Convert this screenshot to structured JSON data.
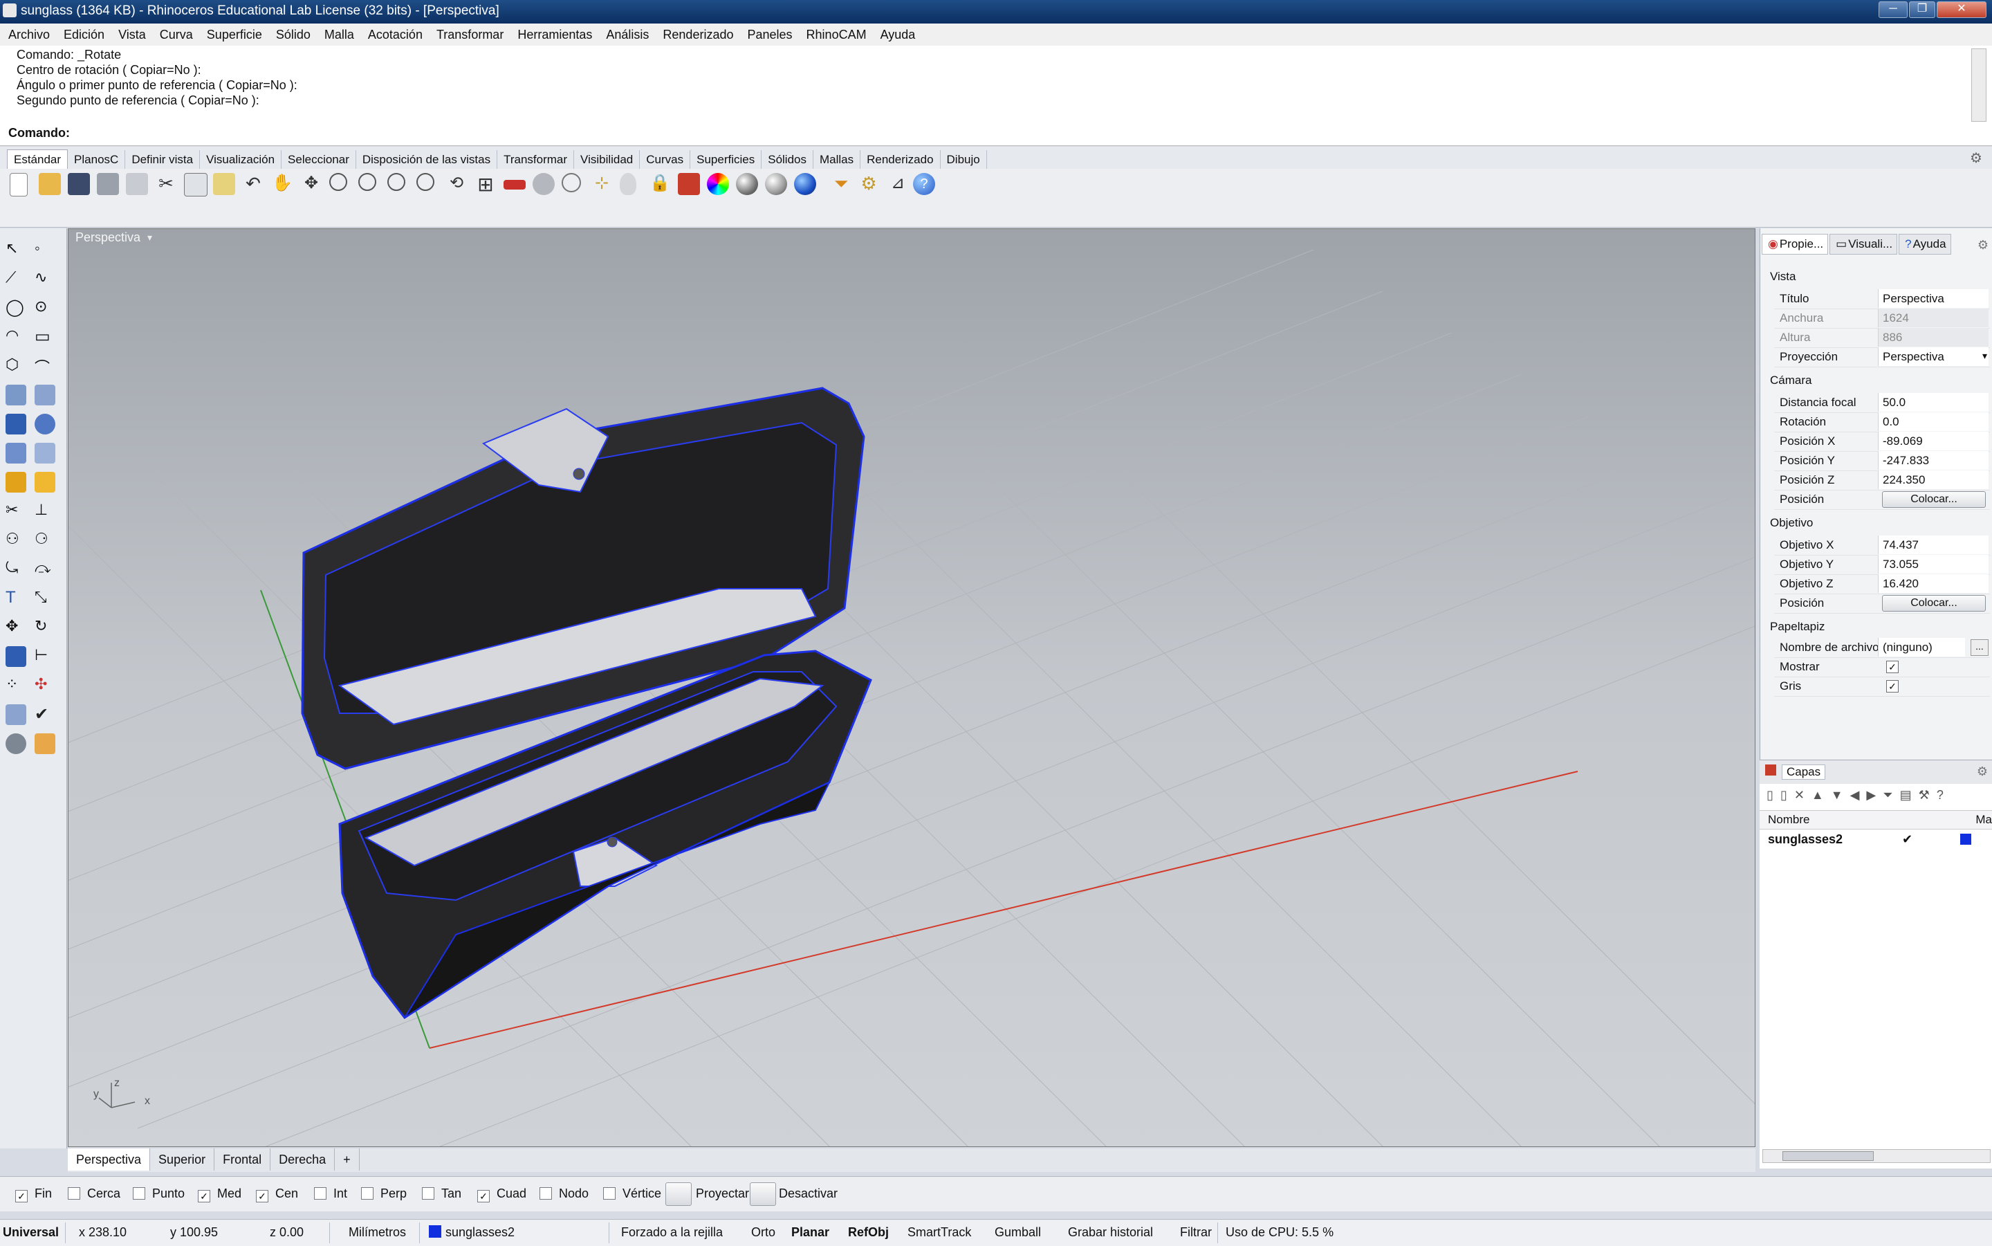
{
  "window": {
    "title": "sunglass (1364 KB) - Rhinoceros Educational Lab License (32 bits) - [Perspectiva]",
    "buttons": {
      "minimize": "─",
      "maximize": "❐",
      "close": "✕"
    }
  },
  "menu": [
    "Archivo",
    "Edición",
    "Vista",
    "Curva",
    "Superficie",
    "Sólido",
    "Malla",
    "Acotación",
    "Transformar",
    "Herramientas",
    "Análisis",
    "Renderizado",
    "Paneles",
    "RhinoCAM",
    "Ayuda"
  ],
  "command_history": [
    "Comando: _Rotate",
    "Centro de rotación ( Copiar=No ):",
    "Ángulo o primer punto de referencia ( Copiar=No ):",
    "Segundo punto de referencia ( Copiar=No ):"
  ],
  "command_prompt": "Comando:",
  "toolbar_tabs": [
    "Estándar",
    "PlanosC",
    "Definir vista",
    "Visualización",
    "Seleccionar",
    "Disposición de las vistas",
    "Transformar",
    "Visibilidad",
    "Curvas",
    "Superficies",
    "Sólidos",
    "Mallas",
    "Renderizado",
    "Dibujo"
  ],
  "viewport": {
    "title": "Perspectiva",
    "axis_labels": {
      "x": "x",
      "y": "y",
      "z": "z"
    }
  },
  "viewport_tabs": [
    "Perspectiva",
    "Superior",
    "Frontal",
    "Derecha",
    "+"
  ],
  "panel": {
    "tabs": [
      "Propie...",
      "Visuali...",
      "Ayuda"
    ],
    "sections": {
      "vista": "Vista",
      "camara": "Cámara",
      "objetivo": "Objetivo",
      "papeltapiz": "Papeltapiz"
    },
    "vista": [
      {
        "k": "Título",
        "v": "Perspectiva"
      },
      {
        "k": "Anchura",
        "v": "1624"
      },
      {
        "k": "Altura",
        "v": "886"
      },
      {
        "k": "Proyección",
        "v": "Perspectiva"
      }
    ],
    "camara": [
      {
        "k": "Distancia focal",
        "v": "50.0"
      },
      {
        "k": "Rotación",
        "v": "0.0"
      },
      {
        "k": "Posición X",
        "v": "-89.069"
      },
      {
        "k": "Posición Y",
        "v": "-247.833"
      },
      {
        "k": "Posición Z",
        "v": "224.350"
      },
      {
        "k": "Posición",
        "v": "Colocar..."
      }
    ],
    "objetivo": [
      {
        "k": "Objetivo X",
        "v": "74.437"
      },
      {
        "k": "Objetivo Y",
        "v": "73.055"
      },
      {
        "k": "Objetivo Z",
        "v": "16.420"
      },
      {
        "k": "Posición",
        "v": "Colocar..."
      }
    ],
    "papeltapiz": [
      {
        "k": "Nombre de archivo",
        "v": "(ninguno)"
      },
      {
        "k": "Mostrar",
        "v": "✓"
      },
      {
        "k": "Gris",
        "v": "✓"
      }
    ],
    "browse": "..."
  },
  "layers": {
    "title": "Capas",
    "col_name": "Nombre",
    "col_mat": "Ma",
    "rows": [
      {
        "name": "sunglasses2",
        "current": "✔",
        "color": "#1030e0"
      }
    ]
  },
  "osnaps": [
    {
      "label": "Fin",
      "checked": true
    },
    {
      "label": "Cerca",
      "checked": false
    },
    {
      "label": "Punto",
      "checked": false
    },
    {
      "label": "Med",
      "checked": true
    },
    {
      "label": "Cen",
      "checked": true
    },
    {
      "label": "Int",
      "checked": false
    },
    {
      "label": "Perp",
      "checked": false
    },
    {
      "label": "Tan",
      "checked": false
    },
    {
      "label": "Cuad",
      "checked": true
    },
    {
      "label": "Nodo",
      "checked": false
    },
    {
      "label": "Vértice",
      "checked": false
    }
  ],
  "osnap_buttons": [
    "Proyectar",
    "Desactivar"
  ],
  "status": {
    "cplane": "Universal",
    "x": "x 238.10",
    "y": "y 100.95",
    "z": "z 0.00",
    "units": "Milímetros",
    "layer": "sunglasses2",
    "layer_color": "#1030e0",
    "grid_snap": "Forzado a la rejilla",
    "ortho": "Orto",
    "planar": "Planar",
    "osnap": "RefObj",
    "smarttrack": "SmartTrack",
    "gumball": "Gumball",
    "history": "Grabar historial",
    "filter": "Filtrar",
    "cpu": "Uso de CPU: 5.5 %"
  },
  "colors": {
    "accent": "#1020e0",
    "grid_x": "#d33a2a",
    "grid_y": "#3a9a3a"
  }
}
